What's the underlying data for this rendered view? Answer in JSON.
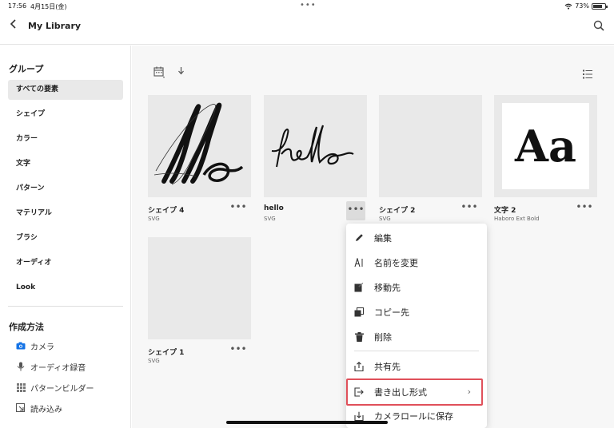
{
  "status": {
    "time": "17:56",
    "date": "4月15日(金)",
    "dots": "•••",
    "battery": "73%"
  },
  "header": {
    "title": "My Library"
  },
  "sidebar": {
    "groups_title": "グループ",
    "items": [
      {
        "label": "すべての要素",
        "active": true
      },
      {
        "label": "シェイプ"
      },
      {
        "label": "カラー"
      },
      {
        "label": "文字"
      },
      {
        "label": "パターン"
      },
      {
        "label": "マテリアル"
      },
      {
        "label": "ブラシ"
      },
      {
        "label": "オーディオ"
      },
      {
        "label": "Look"
      }
    ],
    "create_title": "作成方法",
    "create_methods": [
      {
        "label": "カメラ",
        "icon": "camera-icon"
      },
      {
        "label": "オーディオ録音",
        "icon": "microphone-icon"
      },
      {
        "label": "パターンビルダー",
        "icon": "grid-icon"
      },
      {
        "label": "読み込み",
        "icon": "import-icon"
      }
    ]
  },
  "cards": [
    {
      "name": "シェイプ 4",
      "type": "SVG",
      "more": "•••"
    },
    {
      "name": "hello",
      "type": "SVG",
      "more": "•••"
    },
    {
      "name": "シェイプ 2",
      "type": "SVG",
      "more": "•••"
    },
    {
      "name": "文字 2",
      "type": "Haboro Ext Bold",
      "preview": "Aa",
      "more": "•••"
    },
    {
      "name": "シェイプ 1",
      "type": "SVG",
      "more": "•••"
    }
  ],
  "menu": {
    "items": [
      {
        "label": "編集",
        "icon": "pencil-icon"
      },
      {
        "label": "名前を変更",
        "icon": "rename-icon"
      },
      {
        "label": "移動先",
        "icon": "move-icon"
      },
      {
        "label": "コピー先",
        "icon": "copy-icon"
      },
      {
        "label": "削除",
        "icon": "trash-icon"
      },
      {
        "label": "共有先",
        "icon": "share-icon"
      },
      {
        "label": "書き出し形式",
        "icon": "export-icon",
        "submenu": true,
        "chevron": "›"
      },
      {
        "label": "カメラロールに保存",
        "icon": "save-icon"
      }
    ],
    "highlight_color": "#e0505a"
  },
  "colors": {
    "accent": "#1473e6",
    "sidebar_active": "#e9e9e9",
    "main_bg": "#f7f7f7"
  }
}
